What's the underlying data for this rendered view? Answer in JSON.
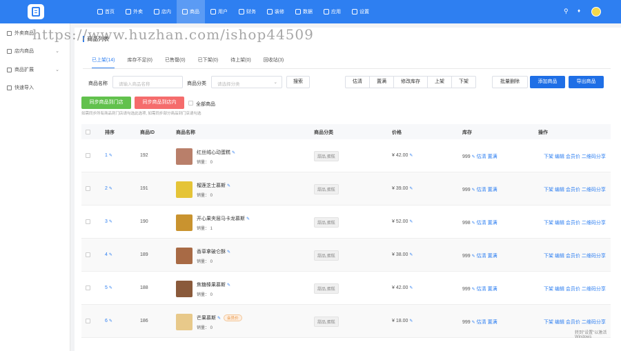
{
  "nav": {
    "items": [
      {
        "label": "首页",
        "icon": "home-icon"
      },
      {
        "label": "外卖",
        "icon": "takeout-icon"
      },
      {
        "label": "店内",
        "icon": "store-icon"
      },
      {
        "label": "商品",
        "icon": "goods-icon",
        "active": true
      },
      {
        "label": "用户",
        "icon": "user-icon"
      },
      {
        "label": "财务",
        "icon": "finance-icon"
      },
      {
        "label": "装修",
        "icon": "decorate-icon"
      },
      {
        "label": "数据",
        "icon": "data-icon"
      },
      {
        "label": "应用",
        "icon": "apps-icon"
      },
      {
        "label": "设置",
        "icon": "settings-icon"
      }
    ]
  },
  "sidebar": {
    "items": [
      {
        "label": "外卖商品",
        "has_chevron": false
      },
      {
        "label": "店内商品",
        "has_chevron": true
      },
      {
        "label": "商品扩展",
        "has_chevron": true
      },
      {
        "label": "快速导入",
        "has_chevron": false
      }
    ]
  },
  "watermark": "https://www.huzhan.com/ishop44509",
  "page": {
    "title": "商品列表"
  },
  "tabs": [
    "已上架(14)",
    "库存不足(0)",
    "已售罄(0)",
    "已下架(0)",
    "待上架(0)",
    "回收站(3)"
  ],
  "filters": {
    "name_label": "商品名称",
    "name_placeholder": "请输入商品名称",
    "category_label": "商品分类",
    "category_placeholder": "请选择分类",
    "search_button": "搜索"
  },
  "batch_actions": [
    "估清",
    "置满",
    "修改库存",
    "上架",
    "下架"
  ],
  "actions": {
    "batch_delete": "批量删除",
    "add_goods": "添加商品",
    "export_goods": "导出商品"
  },
  "sync": {
    "to_store": "同步商品到门店",
    "to_shop": "同步商品到店内",
    "select_all": "全部商品",
    "hint": "如需同步所有商品到门店请勾选此选项, 如需同步部分商品到门店请勾选"
  },
  "table": {
    "headers": [
      "排序",
      "商品ID",
      "商品名称",
      "商品分类",
      "价格",
      "库存",
      "操作"
    ],
    "rows": [
      {
        "sort": "1",
        "id": "192",
        "name": "红丝绒心动蛋糕",
        "sales": "销量： 0",
        "category": "甜品,蛋糕",
        "price": "¥ 42.00",
        "stock": "999",
        "vip": "",
        "thumb": "#b97f6a"
      },
      {
        "sort": "2",
        "id": "191",
        "name": "榴莲芝士慕斯",
        "sales": "销量： 0",
        "category": "甜品,蛋糕",
        "price": "¥ 39.00",
        "stock": "999",
        "vip": "",
        "thumb": "#e5c437"
      },
      {
        "sort": "3",
        "id": "190",
        "name": "开心果夹层马卡龙慕斯",
        "sales": "销量： 1",
        "category": "甜品,蛋糕",
        "price": "¥ 52.00",
        "stock": "998",
        "vip": "",
        "thumb": "#c9932f"
      },
      {
        "sort": "4",
        "id": "189",
        "name": "香草拿破仑酥",
        "sales": "销量： 0",
        "category": "甜品,蛋糕",
        "price": "¥ 38.00",
        "stock": "999",
        "vip": "",
        "thumb": "#a86a45"
      },
      {
        "sort": "5",
        "id": "188",
        "name": "焦糖榛果慕斯",
        "sales": "销量： 0",
        "category": "甜品,蛋糕",
        "price": "¥ 42.00",
        "stock": "999",
        "vip": "",
        "thumb": "#8a5a3b"
      },
      {
        "sort": "6",
        "id": "186",
        "name": "芒果慕斯",
        "sales": "销量： 0",
        "category": "甜品,蛋糕",
        "price": "¥ 18.00",
        "stock": "999",
        "vip": "会员价",
        "thumb": "#e8c98a"
      }
    ],
    "row_actions": [
      "下架",
      "编辑",
      "会员价",
      "二维码分享"
    ],
    "stock_actions": [
      "估清",
      "置满"
    ]
  },
  "float_note": "转到\"设置\"以激活 Windows"
}
